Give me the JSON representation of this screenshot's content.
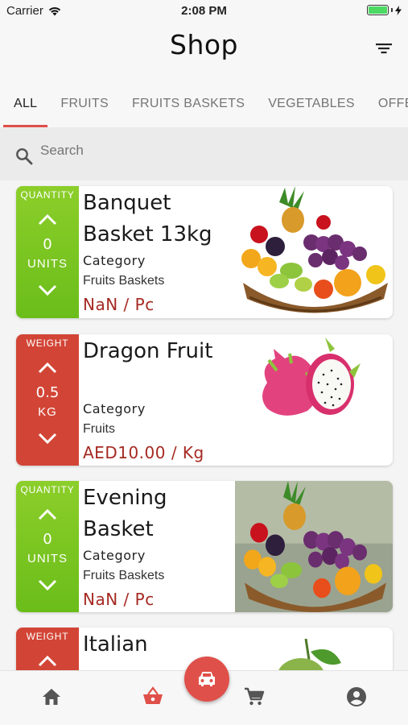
{
  "status_bar": {
    "carrier": "Carrier",
    "time": "2:08 PM"
  },
  "header": {
    "title": "Shop"
  },
  "tabs": [
    {
      "label": "ALL",
      "active": true
    },
    {
      "label": "FRUITS",
      "active": false
    },
    {
      "label": "FRUITS BASKETS",
      "active": false
    },
    {
      "label": "VEGETABLES",
      "active": false
    },
    {
      "label": "OFFERS",
      "active": false
    }
  ],
  "search": {
    "placeholder": "Search"
  },
  "products": [
    {
      "name_line1": "Banquet",
      "name_line2": "Basket 13kg",
      "stepper_label": "QUANTITY",
      "quantity": "0",
      "unit": "UNITS",
      "category_label": "Category",
      "category": "Fruits Baskets",
      "price": "NaN / Pc",
      "stepper_color": "green"
    },
    {
      "name_line1": "Dragon Fruit",
      "name_line2": "",
      "stepper_label": "WEIGHT",
      "quantity": "0.5",
      "unit": "KG",
      "category_label": "Category",
      "category": "Fruits",
      "price": "AED10.00 / Kg",
      "stepper_color": "red"
    },
    {
      "name_line1": "Evening",
      "name_line2": "Basket",
      "stepper_label": "QUANTITY",
      "quantity": "0",
      "unit": "UNITS",
      "category_label": "Category",
      "category": "Fruits Baskets",
      "price": "NaN / Pc",
      "stepper_color": "green"
    },
    {
      "name_line1": "Italian",
      "name_line2": "",
      "stepper_label": "WEIGHT",
      "quantity": "",
      "unit": "",
      "category_label": "",
      "category": "",
      "price": "",
      "stepper_color": "red"
    }
  ],
  "colors": {
    "accent": "#e0504a",
    "green": "#7cc520",
    "red": "#d24536",
    "price": "#a52a22"
  },
  "bottom_nav": [
    "home-icon",
    "basket-icon",
    "car-icon",
    "cart-icon",
    "account-icon"
  ]
}
